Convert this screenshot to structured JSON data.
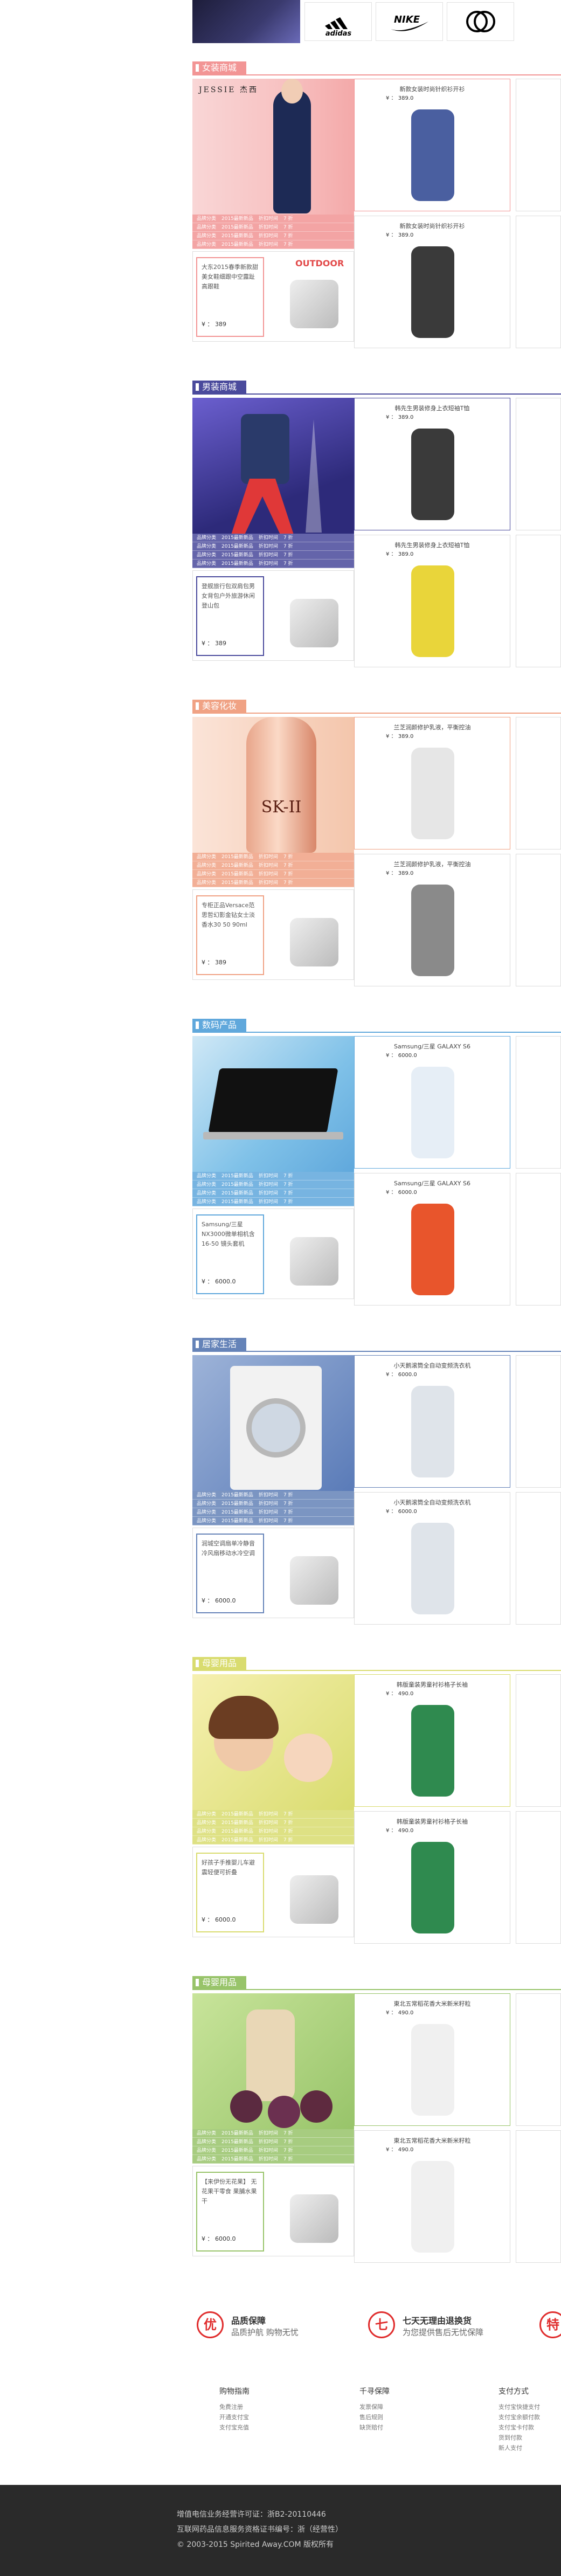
{
  "brands": [
    {
      "name": "adidas",
      "icon": "adidas-logo"
    },
    {
      "name": "NIKE",
      "icon": "nike-swoosh-logo"
    },
    {
      "name": "GUCCI",
      "icon": "gucci-logo"
    }
  ],
  "stat_labels": {
    "brand": "品牌分类",
    "year": "2015最新新品",
    "discount": "折扣时间",
    "tag": "7 折"
  },
  "sections": [
    {
      "title": "女装商城",
      "color": "#f29595",
      "hero": "women-model",
      "hero_text": "JESSIE 杰西",
      "promo": {
        "text": "大东2015春季新款甜美女鞋细跟中空露趾高跟鞋",
        "price": "¥ ： 389",
        "tag": "OUTDOOR"
      },
      "products": [
        {
          "name": "新款女装时尚针织衫开衫",
          "price": "¥ ： 389.0"
        },
        {
          "name": "新款女装时尚针织衫开衫",
          "price": "¥ ： 389.0"
        }
      ]
    },
    {
      "title": "男装商城",
      "color": "#4a4a9c",
      "hero": "men-model",
      "promo": {
        "text": "登舰旅行包双肩包男女背包户外旅游休闲登山包",
        "price": "¥ ： 389",
        "tag": ""
      },
      "products": [
        {
          "name": "韩先生男装修身上衣短袖T恤",
          "price": "¥ ： 389.0"
        },
        {
          "name": "韩先生男装修身上衣短袖T恤",
          "price": "¥ ： 389.0"
        }
      ]
    },
    {
      "title": "美容化妆",
      "color": "#f0a284",
      "hero": "skii-bottle",
      "hero_text": "SK-II",
      "promo": {
        "text": "专柜正品Versace范思哲幻影金钻女士淡香水30 50 90ml",
        "price": "¥ ： 389",
        "tag": ""
      },
      "products": [
        {
          "name": "兰芝润颜修护乳液，平衡控油",
          "price": "¥ ： 389.0"
        },
        {
          "name": "兰芝润颜修护乳液，平衡控油",
          "price": "¥ ： 389.0"
        }
      ]
    },
    {
      "title": "数码产品",
      "color": "#60a8dc",
      "hero": "laptop",
      "promo": {
        "text": "Samsung/三星 NX3000微单相机含16-50 镜头套机",
        "price": "¥ ： 6000.0",
        "tag": ""
      },
      "products": [
        {
          "name": "Samsung/三星 GALAXY S6",
          "price": "¥ ： 6000.0"
        },
        {
          "name": "Samsung/三星 GALAXY S6",
          "price": "¥ ： 6000.0"
        }
      ]
    },
    {
      "title": "居家生活",
      "color": "#6583b8",
      "hero": "washing-machine",
      "promo": {
        "text": "润城空调扇单冷静音冷风扇移动水冷空调",
        "price": "¥ ： 6000.0",
        "tag": ""
      },
      "products": [
        {
          "name": "小天鹅滚筒全自动变频洗衣机",
          "price": "¥ ： 6000.0"
        },
        {
          "name": "小天鹅滚筒全自动变频洗衣机",
          "price": "¥ ： 6000.0"
        }
      ]
    },
    {
      "title": "母婴用品",
      "color": "#d9dc6f",
      "hero": "mother-baby",
      "promo": {
        "text": "好孩子手推婴儿车避震轻便可折叠",
        "price": "¥ ： 6000.0",
        "tag": ""
      },
      "products": [
        {
          "name": "韩版童装男童衬衫格子长袖",
          "price": "¥ ： 490.0"
        },
        {
          "name": "韩版童装男童衬衫格子长袖",
          "price": "¥ ： 490.0"
        }
      ]
    },
    {
      "title": "母婴用品",
      "color": "#98c46a",
      "hero": "figs-food",
      "promo": {
        "text": "【来伊份无花果】 无花果干零食 果脯水果干",
        "price": "¥ ： 6000.0",
        "tag": ""
      },
      "products": [
        {
          "name": "東北五常稻花香大米新米籽粒",
          "price": "¥ ： 490.0"
        },
        {
          "name": "東北五常稻花香大米新米籽粒",
          "price": "¥ ： 490.0"
        }
      ]
    }
  ],
  "services": [
    {
      "icon": "优",
      "title": "品质保障",
      "desc": "品质护航 购物无忧"
    },
    {
      "icon": "七",
      "title": "七天无理由退换货",
      "desc": "为您提供售后无忧保障"
    },
    {
      "icon": "特",
      "title": "",
      "desc": ""
    }
  ],
  "help": [
    {
      "title": "购物指南",
      "links": [
        "免费注册",
        "开通支付宝",
        "支付宝充值"
      ]
    },
    {
      "title": "千寻保障",
      "links": [
        "发票保障",
        "售后规则",
        "缺货赔付"
      ]
    },
    {
      "title": "支付方式",
      "links": [
        "支付宝快捷支付",
        "支付宝余额付款",
        "支付宝卡付款",
        "货到付款",
        "新人支付"
      ]
    }
  ],
  "footer": {
    "line1": "增值电信业务经营许可证：浙B2-20110446",
    "line2": "互联网药品信息服务资格证书编号：浙（经营性）",
    "line3": "© 2003-2015 Spirited Away.COM 版权所有"
  }
}
